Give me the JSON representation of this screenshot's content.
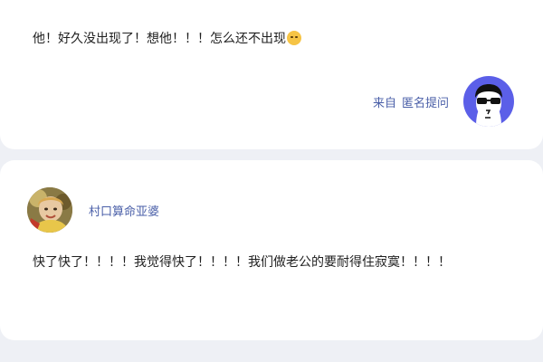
{
  "question": {
    "text": "他！好久没出现了！想他！！！怎么还不出现",
    "emoji_icon": "crying-face-icon",
    "from_label": "来自",
    "from_name": "匿名提问",
    "avatar_icon": "anonymous-sunglasses-avatar",
    "avatar_color": "#5b5fe8"
  },
  "answer": {
    "username": "村口算命亚婆",
    "text": "快了快了！！！！我觉得快了！！！！我们做老公的要耐得住寂寞！！！！"
  },
  "colors": {
    "background": "#eef0f5",
    "card": "#ffffff",
    "link_blue": "#4a5fa8",
    "body_text": "#1f1f1f"
  }
}
